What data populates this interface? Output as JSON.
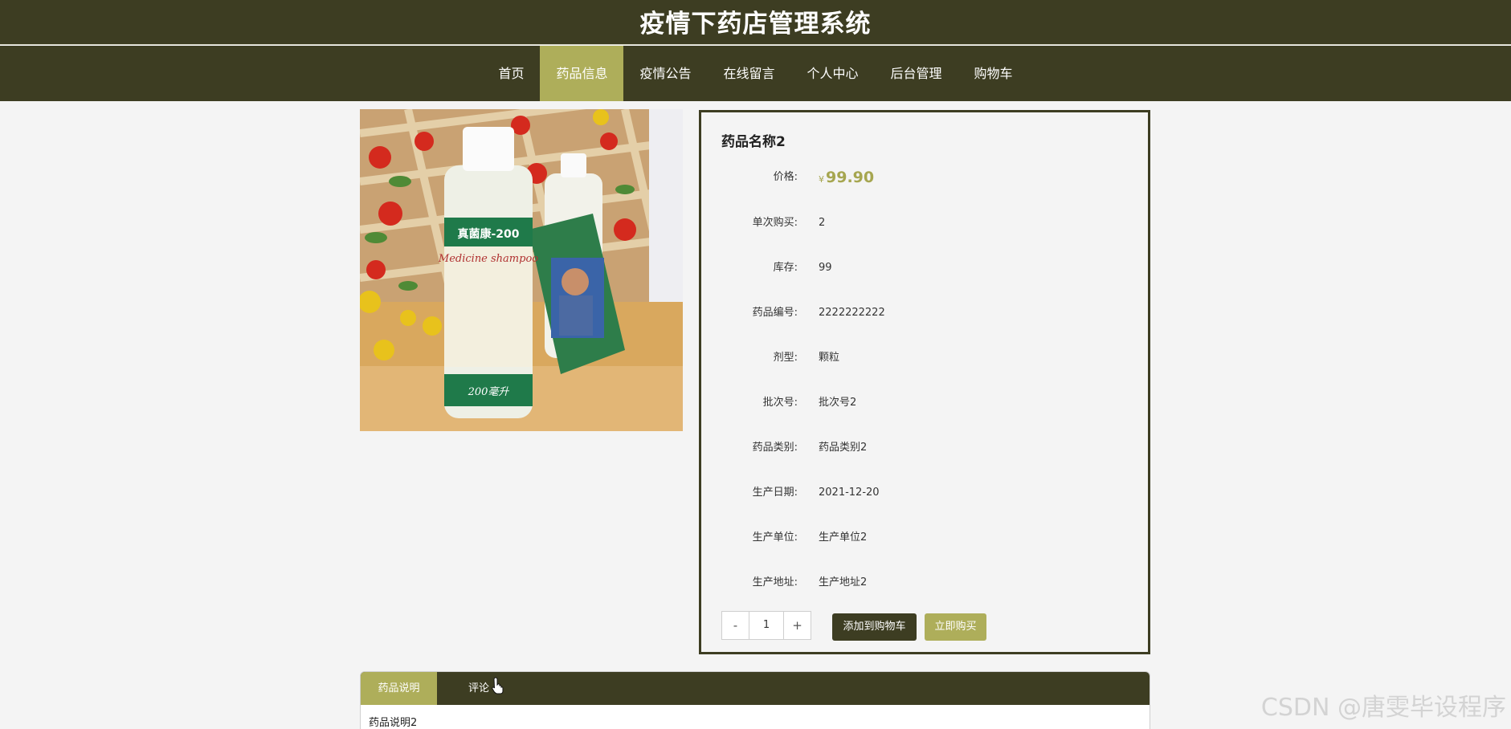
{
  "header": {
    "title": "疫情下药店管理系统"
  },
  "nav": {
    "items": [
      {
        "label": "首页",
        "active": false
      },
      {
        "label": "药品信息",
        "active": true
      },
      {
        "label": "疫情公告",
        "active": false
      },
      {
        "label": "在线留言",
        "active": false
      },
      {
        "label": "个人中心",
        "active": false
      },
      {
        "label": "后台管理",
        "active": false
      },
      {
        "label": "购物车",
        "active": false
      }
    ]
  },
  "product": {
    "name": "药品名称2",
    "price_label": "价格:",
    "currency": "¥",
    "price": "99.90",
    "fields": [
      {
        "label": "单次购买:",
        "value": "2"
      },
      {
        "label": "库存:",
        "value": "99"
      },
      {
        "label": "药品编号:",
        "value": "2222222222"
      },
      {
        "label": "剂型:",
        "value": "颗粒"
      },
      {
        "label": "批次号:",
        "value": "批次号2"
      },
      {
        "label": "药品类别:",
        "value": "药品类别2"
      },
      {
        "label": "生产日期:",
        "value": "2021-12-20"
      },
      {
        "label": "生产单位:",
        "value": "生产单位2"
      },
      {
        "label": "生产地址:",
        "value": "生产地址2"
      }
    ],
    "image_label_cn": "真菌康-200",
    "image_label_en": "Medicine shampoo",
    "image_label_volume": "200毫升"
  },
  "purchase": {
    "minus": "-",
    "quantity": "1",
    "plus": "+",
    "add_to_cart": "添加到购物车",
    "buy_now": "立即购买"
  },
  "tabs": {
    "items": [
      {
        "label": "药品说明",
        "active": true
      },
      {
        "label": "评论",
        "active": false
      }
    ],
    "content": "药品说明2"
  },
  "watermark": "CSDN @唐雯毕设程序",
  "colors": {
    "header_bg": "#3d3d22",
    "accent": "#aeae5a",
    "page_bg": "#f4f4f4"
  }
}
